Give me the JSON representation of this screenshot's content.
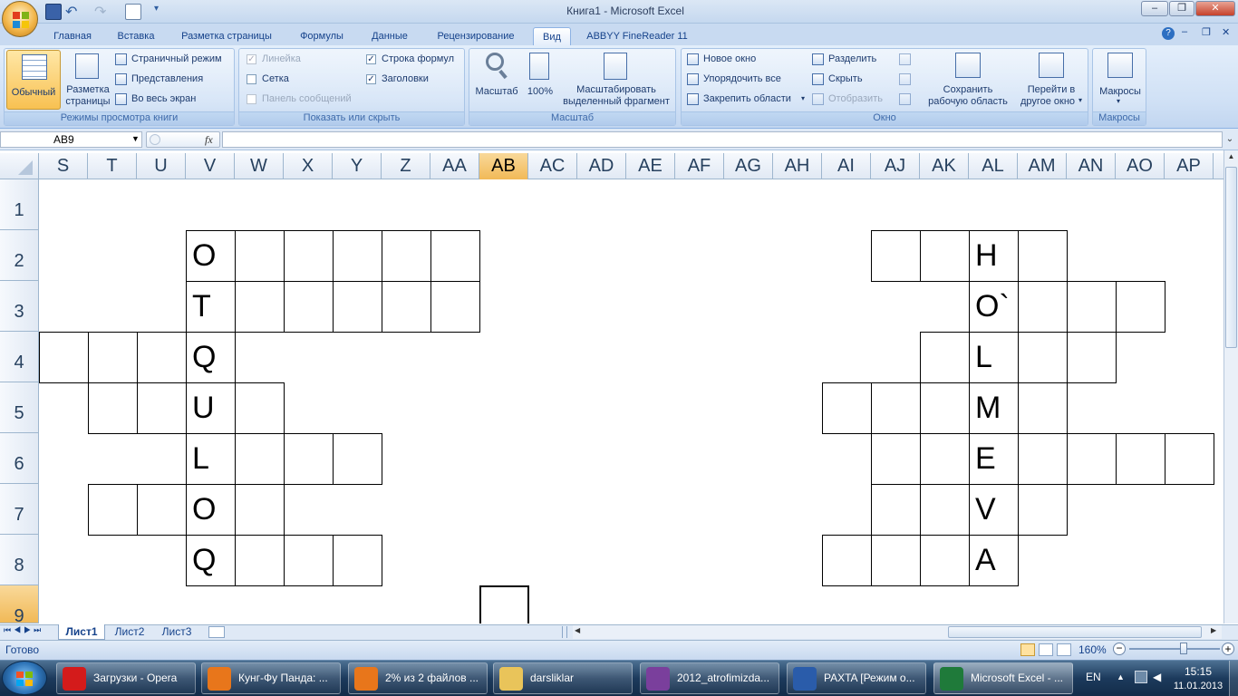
{
  "window": {
    "title": "Книга1 - Microsoft Excel"
  },
  "qat": {
    "items": [
      "save-icon",
      "undo-icon",
      "redo-icon",
      "print-preview-icon",
      "customize-icon"
    ]
  },
  "window_controls": {
    "minimize": "–",
    "restore": "❐",
    "close": "✕"
  },
  "ribbon_tabs": [
    "Главная",
    "Вставка",
    "Разметка страницы",
    "Формулы",
    "Данные",
    "Рецензирование",
    "Вид",
    "ABBYY FineReader 11"
  ],
  "active_tab": "Вид",
  "ribbon_right": {
    "help": "?",
    "min": "–",
    "restore": "❐",
    "close": "✕"
  },
  "groups": {
    "views": {
      "label": "Режимы просмотра книги",
      "normal": "Обычный",
      "layout": "Разметка\nстраницы",
      "layout_line1": "Разметка",
      "layout_line2": "страницы",
      "page_break": "Страничный режим",
      "custom_views": "Представления",
      "full_screen": "Во весь экран"
    },
    "show": {
      "label": "Показать или скрыть",
      "ruler": "Линейка",
      "formula_bar": "Строка формул",
      "gridlines": "Сетка",
      "headings": "Заголовки",
      "message_bar": "Панель сообщений",
      "check": "✓"
    },
    "zoom": {
      "label": "Масштаб",
      "zoom": "Масштаб",
      "hundred": "100%",
      "sel_line1": "Масштабировать",
      "sel_line2": "выделенный фрагмент"
    },
    "window": {
      "label": "Окно",
      "new_window": "Новое окно",
      "arrange_all": "Упорядочить все",
      "freeze": "Закрепить области",
      "split": "Разделить",
      "hide": "Скрыть",
      "unhide": "Отобразить",
      "save_ws_line1": "Сохранить",
      "save_ws_line2": "рабочую область",
      "switch_line1": "Перейти в",
      "switch_line2": "другое окно"
    },
    "macros": {
      "label": "Макросы",
      "macros": "Макросы"
    }
  },
  "formula_bar": {
    "name_box": "AB9",
    "fx": "fx",
    "value": ""
  },
  "columns": [
    "S",
    "T",
    "U",
    "V",
    "W",
    "X",
    "Y",
    "Z",
    "AA",
    "AB",
    "AC",
    "AD",
    "AE",
    "AF",
    "AG",
    "AH",
    "AI",
    "AJ",
    "AK",
    "AL",
    "AM",
    "AN",
    "AO",
    "AP"
  ],
  "selected_column": "AB",
  "rows": [
    "1",
    "2",
    "3",
    "4",
    "5",
    "6",
    "7",
    "8",
    "9"
  ],
  "selected_row": "9",
  "cells": {
    "V2": "O",
    "V3": "T",
    "V4": "Q",
    "V5": "U",
    "V6": "L",
    "V7": "O",
    "V8": "Q",
    "AL2": "H",
    "AL3": "O`",
    "AL4": "L",
    "AL5": "M",
    "AL6": "E",
    "AL7": "V",
    "AL8": "A"
  },
  "bordered_cells": [
    "V2",
    "W2",
    "X2",
    "Y2",
    "Z2",
    "AA2",
    "V3",
    "W3",
    "X3",
    "Y3",
    "Z3",
    "AA3",
    "S4",
    "T4",
    "U4",
    "V4",
    "T5",
    "U5",
    "V5",
    "W5",
    "V6",
    "W6",
    "X6",
    "Y6",
    "T7",
    "U7",
    "V7",
    "W7",
    "V8",
    "W8",
    "X8",
    "Y8",
    "AB9",
    "AJ2",
    "AK2",
    "AL2",
    "AM2",
    "AL3",
    "AM3",
    "AN3",
    "AO3",
    "AK4",
    "AL4",
    "AM4",
    "AN4",
    "AI5",
    "AJ5",
    "AK5",
    "AL5",
    "AM5",
    "AJ6",
    "AK6",
    "AL6",
    "AM6",
    "AN6",
    "AO6",
    "AP6",
    "AJ7",
    "AK7",
    "AL7",
    "AM7",
    "AI8",
    "AJ8",
    "AK8",
    "AL8"
  ],
  "sheet_tabs": [
    "Лист1",
    "Лист2",
    "Лист3"
  ],
  "active_sheet": "Лист1",
  "status": {
    "ready": "Готово",
    "zoom": "160%",
    "zoom_level_percent": 160
  },
  "taskbar": {
    "items": [
      {
        "label": "Загрузки - Opera",
        "icon": "opera-icon",
        "color": "#d41b1b"
      },
      {
        "label": "Кунг-Фу Панда: ...",
        "icon": "firefox-icon",
        "color": "#e8761b"
      },
      {
        "label": "2% из 2 файлов ...",
        "icon": "firefox-icon",
        "color": "#e8761b"
      },
      {
        "label": "darsliklar",
        "icon": "folder-icon",
        "color": "#e9c45a"
      },
      {
        "label": "2012_atrofimizda...",
        "icon": "winrar-icon",
        "color": "#7a3f9c"
      },
      {
        "label": "PAXTA [Режим о...",
        "icon": "word-icon",
        "color": "#2a5caa"
      },
      {
        "label": "Microsoft Excel - ...",
        "icon": "excel-icon",
        "color": "#1f7a3a"
      }
    ],
    "lang": "EN",
    "time": "15:15",
    "date": "11.01.2013"
  }
}
